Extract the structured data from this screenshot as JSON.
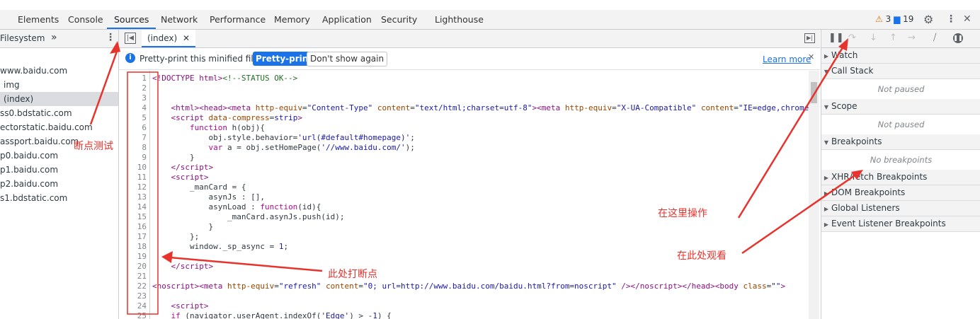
{
  "tabs": [
    "Elements",
    "Console",
    "Sources",
    "Network",
    "Performance",
    "Memory",
    "Application",
    "Security",
    "Lighthouse"
  ],
  "status": {
    "warnings": "3",
    "messages": "19"
  },
  "navigator": {
    "tab": "Filesystem",
    "more": "»",
    "items": [
      "www.baidu.com",
      "img",
      "(index)",
      "ss0.bdstatic.com",
      "ectorstatic.baidu.com",
      "assport.baidu.com",
      "p0.baidu.com",
      "p1.baidu.com",
      "p2.baidu.com",
      "s1.bdstatic.com"
    ]
  },
  "editor": {
    "file_tab": "(index)",
    "info": "Pretty-print this minified file?",
    "pretty_btn": "Pretty-print",
    "dont_show": "Don't show again",
    "learn_more": "Learn more",
    "line_numbers": [
      "1",
      "2",
      "3",
      "4",
      "5",
      "6",
      "7",
      "8",
      "9",
      "10",
      "11",
      "12",
      "13",
      "14",
      "15",
      "16",
      "17",
      "18",
      "19",
      "20",
      "21",
      "22",
      "23",
      "24",
      "25"
    ]
  },
  "debugger": {
    "sections": {
      "watch": "Watch",
      "call_stack": "Call Stack",
      "not_paused_1": "Not paused",
      "scope": "Scope",
      "not_paused_2": "Not paused",
      "breakpoints": "Breakpoints",
      "no_breakpoints": "No breakpoints",
      "xhr": "XHR/fetch Breakpoints",
      "dom": "DOM Breakpoints",
      "global": "Global Listeners",
      "event": "Event Listener Breakpoints"
    }
  },
  "annotations": {
    "breakpoint_test": "断点测试",
    "set_breakpoint_here": "此处打断点",
    "operate_here": "在这里操作",
    "watch_here": "在此处观看"
  },
  "colors": {
    "accent": "#1a73e8",
    "annotation": "#e8322c"
  }
}
